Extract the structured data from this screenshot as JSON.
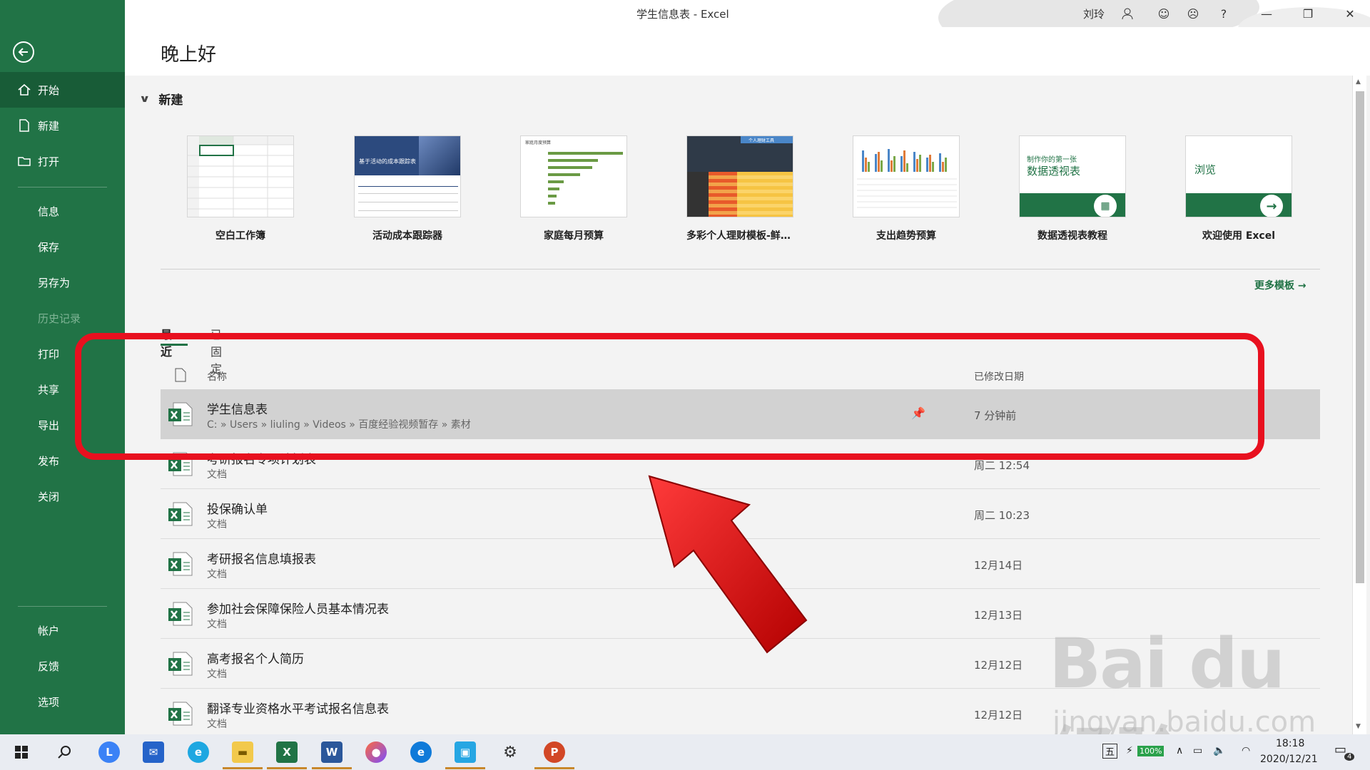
{
  "window": {
    "title": "学生信息表  -  Excel",
    "user": "刘玲"
  },
  "sidebar": {
    "items": [
      {
        "label": "开始",
        "icon": "home-icon"
      },
      {
        "label": "新建",
        "icon": "new-doc-icon"
      },
      {
        "label": "打开",
        "icon": "folder-icon"
      },
      {
        "label": "信息"
      },
      {
        "label": "保存"
      },
      {
        "label": "另存为"
      },
      {
        "label": "历史记录"
      },
      {
        "label": "打印"
      },
      {
        "label": "共享"
      },
      {
        "label": "导出"
      },
      {
        "label": "发布"
      },
      {
        "label": "关闭"
      },
      {
        "label": "帐户"
      },
      {
        "label": "反馈"
      },
      {
        "label": "选项"
      }
    ]
  },
  "greeting": "晚上好",
  "new_section": {
    "title": "新建",
    "templates": [
      {
        "label": "空白工作簿"
      },
      {
        "label": "活动成本跟踪器",
        "thumb_text": "基于活动的成本跟踪表"
      },
      {
        "label": "家庭每月预算",
        "thumb_text": "家庭月度预算"
      },
      {
        "label": "多彩个人理财模板-鲜艳明...",
        "thumb_text": "个人理财工具"
      },
      {
        "label": "支出趋势预算"
      },
      {
        "label": "数据透视表教程",
        "thumb_line1": "制作你的第一张",
        "thumb_line2": "数据透视表"
      },
      {
        "label": "欢迎使用 Excel",
        "thumb_text": "浏览"
      }
    ],
    "more_label": "更多模板"
  },
  "tabs": {
    "recent": "最近",
    "pinned": "已固定"
  },
  "list": {
    "col_name": "名称",
    "col_date": "已修改日期",
    "rows": [
      {
        "name": "学生信息表",
        "path": "C: » Users » liuling » Videos » 百度经验视频暂存 » 素材",
        "date": "7 分钟前",
        "selected": true
      },
      {
        "name": "考研报名专项计划表",
        "path": "文档",
        "date": "周二 12:54"
      },
      {
        "name": "投保确认单",
        "path": "文档",
        "date": "周二 10:23"
      },
      {
        "name": "考研报名信息填报表",
        "path": "文档",
        "date": "12月14日"
      },
      {
        "name": "参加社会保障保险人员基本情况表",
        "path": "文档",
        "date": "12月13日"
      },
      {
        "name": "高考报名个人简历",
        "path": "文档",
        "date": "12月12日"
      },
      {
        "name": "翻译专业资格水平考试报名信息表",
        "path": "文档",
        "date": "12月12日"
      }
    ]
  },
  "watermark": {
    "brand": "Bai du 经验",
    "url": "jingyan.baidu.com"
  },
  "taskbar": {
    "ime": "五",
    "battery": "100%",
    "time": "18:18",
    "date": "2020/12/21",
    "notifications": "4"
  },
  "colors": {
    "accent": "#217346",
    "highlight": "#e8101f"
  }
}
